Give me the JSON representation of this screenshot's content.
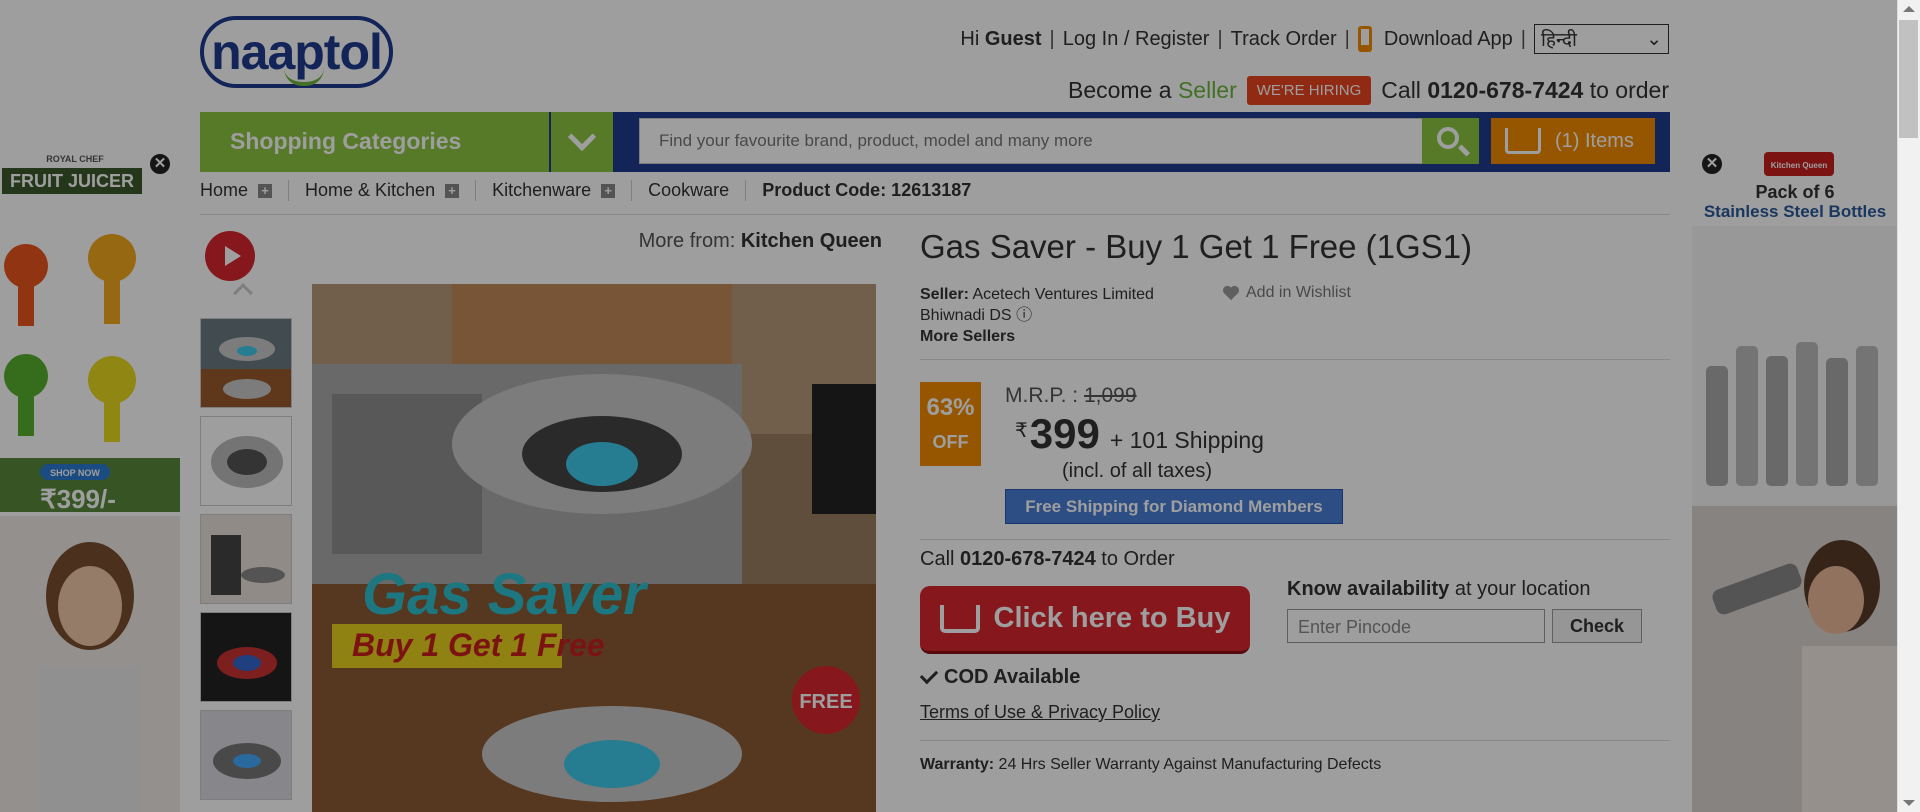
{
  "header": {
    "logo_text": "naaptol",
    "greeting_prefix": "Hi",
    "greeting_name": "Guest",
    "login_label": "Log In / Register",
    "track_label": "Track Order",
    "download_label": "Download App",
    "language_value": "हिन्दी",
    "become_prefix": "Become a",
    "seller_label": "Seller",
    "hiring_label": "WE'RE HIRING",
    "call_prefix": "Call",
    "call_number": "0120-678-7424",
    "call_suffix": "to order"
  },
  "nav": {
    "categories_label": "Shopping Categories",
    "search_placeholder": "Find your favourite brand, product, model and many more",
    "cart_label": "(1) Items"
  },
  "breadcrumb": {
    "items": [
      "Home",
      "Home & Kitchen",
      "Kitchenware",
      "Cookware"
    ],
    "product_code": "Product Code: 12613187"
  },
  "gallery": {
    "more_from_prefix": "More from:",
    "brand": "Kitchen Queen",
    "main_text1": "Gas Saver",
    "main_text2": "Buy 1 Get 1 Free",
    "main_badge": "FREE"
  },
  "product": {
    "title": "Gas Saver - Buy 1 Get 1 Free (1GS1)",
    "seller_label": "Seller:",
    "seller_name": "Acetech Ventures Limited",
    "seller_location": "Bhiwnadi DS",
    "more_sellers": "More Sellers",
    "wishlist": "Add in Wishlist",
    "discount_pct": "63%",
    "discount_off": "OFF",
    "mrp_label": "M.R.P. :",
    "mrp_value": "1,099",
    "rupee": "₹",
    "price": "399",
    "shipping": "+ 101 Shipping",
    "incl_taxes": "(incl. of all taxes)",
    "free_shipping": "Free Shipping for Diamond Members",
    "call_prefix": "Call",
    "call_number": "0120-678-7424",
    "call_suffix": "to Order",
    "buy_label": "Click here to Buy",
    "know_bold": "Know availability",
    "know_rest": "at your location",
    "pincode_placeholder": "Enter Pincode",
    "check_label": "Check",
    "cod": "COD Available",
    "terms": "Terms of Use & Privacy Policy",
    "warranty_label": "Warranty:",
    "warranty_text": "24 Hrs Seller Warranty Against Manufacturing Defects"
  },
  "ads": {
    "left_brand": "ROYAL CHEF",
    "left_title": "FRUIT JUICER",
    "left_cta": "SHOP NOW",
    "left_price": "₹399/-",
    "right_brand": "Kitchen Queen",
    "right_title1": "Pack of 6",
    "right_title2": "Stainless Steel Bottles",
    "close": "✕"
  }
}
